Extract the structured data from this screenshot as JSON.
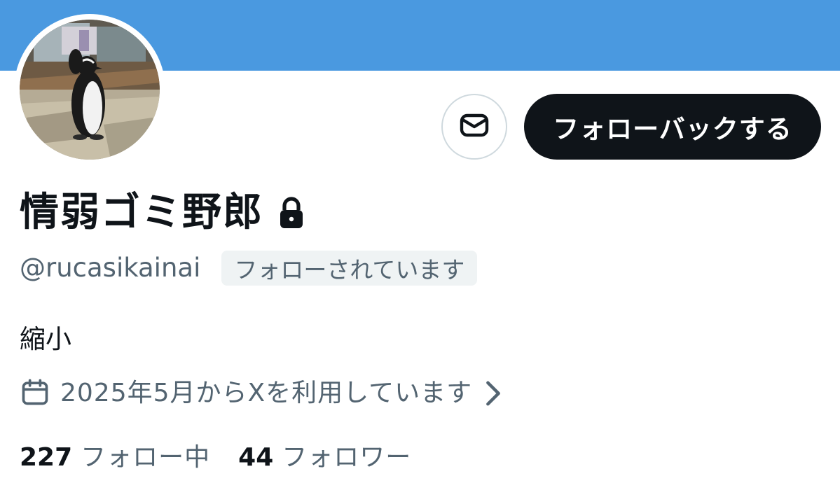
{
  "profile": {
    "display_name": "情弱ゴミ野郎",
    "handle": "@rucasikainai",
    "follows_you_badge": "フォローされています",
    "bio": "縮小",
    "joined_text": "2025年5月からXを利用しています",
    "protected": true
  },
  "actions": {
    "follow_back_label": "フォローバックする",
    "message_icon": "envelope-icon"
  },
  "stats": {
    "following_count": "227",
    "following_label": "フォロー中",
    "followers_count": "44",
    "followers_label": "フォロワー"
  },
  "colors": {
    "banner": "#4a99e0",
    "primary_text": "#0f1419",
    "secondary_text": "#536471",
    "button_bg": "#0f1419",
    "badge_bg": "#eff3f4",
    "border": "#cfd9de"
  },
  "icons": {
    "lock": "lock-icon",
    "calendar": "calendar-icon",
    "chevron": "chevron-right-icon"
  }
}
